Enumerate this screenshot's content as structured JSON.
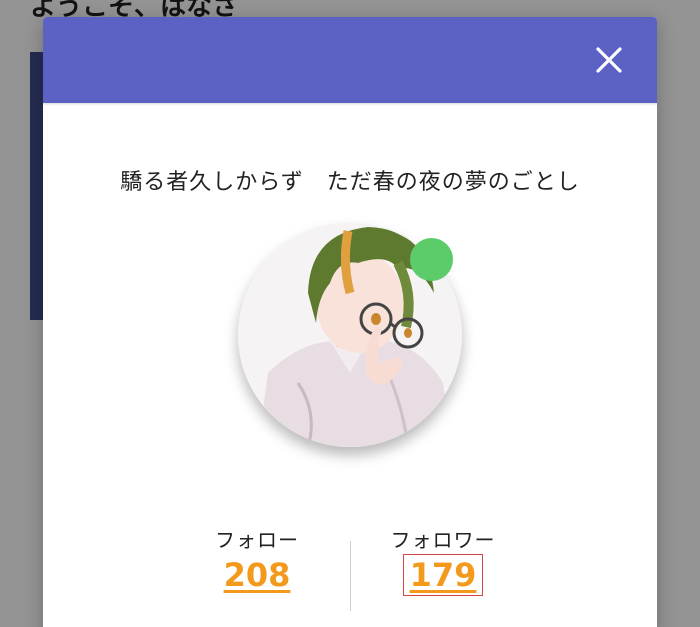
{
  "background": {
    "greeting": "ようこそ、はなさ"
  },
  "modal": {
    "header_color": "#5c61c4",
    "close_icon": "close-icon",
    "bio": "驕る者久しからず　ただ春の夜の夢のごとし",
    "avatar": {
      "online": true,
      "online_color": "#5ccb6a"
    },
    "stats": {
      "following": {
        "label": "フォロー",
        "count": "208"
      },
      "followers": {
        "label": "フォロワー",
        "count": "179"
      }
    },
    "accent_color": "#f39a1c"
  }
}
